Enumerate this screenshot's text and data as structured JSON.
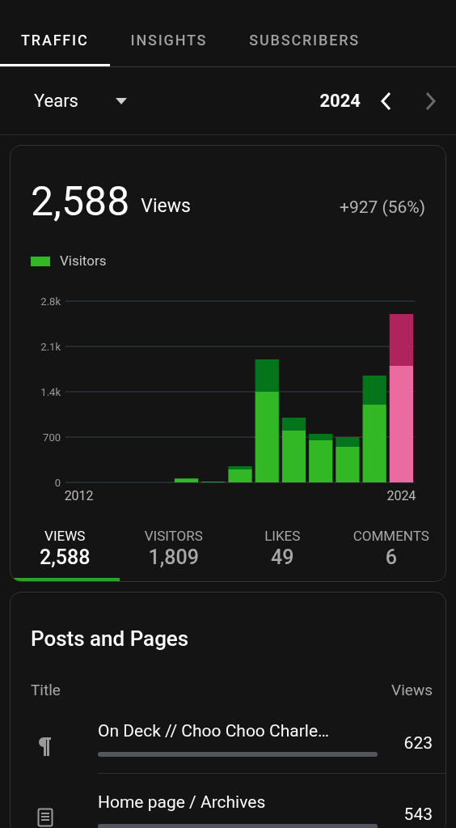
{
  "tabs": [
    {
      "label": "TRAFFIC",
      "selected": true
    },
    {
      "label": "INSIGHTS",
      "selected": false
    },
    {
      "label": "SUBSCRIBERS",
      "selected": false
    }
  ],
  "period": {
    "value": "Years",
    "year": "2024",
    "prev_enabled": true,
    "next_enabled": false
  },
  "summary": {
    "total": "2,588",
    "unit": "Views",
    "change": "+927 (56%)",
    "chart_data": {
      "type": "bar",
      "stacked": true,
      "grid": true,
      "x": [
        2012,
        2013,
        2014,
        2015,
        2016,
        2017,
        2018,
        2019,
        2020,
        2021,
        2022,
        2023,
        2024
      ],
      "series": [
        {
          "name": "Visitors",
          "color": "#32b825",
          "values": [
            0,
            0,
            0,
            0,
            60,
            10,
            200,
            1400,
            800,
            650,
            550,
            1200,
            null
          ]
        },
        {
          "color": "#05751b",
          "values": [
            0,
            0,
            0,
            0,
            0,
            0,
            50,
            500,
            200,
            100,
            150,
            450,
            null
          ]
        },
        {
          "color": "#eb6aa0",
          "values": [
            null,
            null,
            null,
            null,
            null,
            null,
            null,
            null,
            null,
            null,
            null,
            null,
            1800
          ]
        },
        {
          "color": "#b0245e",
          "values": [
            null,
            null,
            null,
            null,
            null,
            null,
            null,
            null,
            null,
            null,
            null,
            null,
            800
          ]
        }
      ],
      "xlim": [
        2011.5,
        2024.5
      ],
      "ylim": [
        0,
        2800
      ],
      "yticks": [
        {
          "value": 0,
          "label": "0"
        },
        {
          "value": 700,
          "label": "700"
        },
        {
          "value": 1400,
          "label": "1.4k"
        },
        {
          "value": 2100,
          "label": "2.1k"
        },
        {
          "value": 2800,
          "label": "2.8k"
        }
      ],
      "xticks": [
        {
          "value": 2012,
          "label": "2012"
        },
        {
          "value": 2024,
          "label": "2024"
        }
      ]
    },
    "stats": [
      {
        "label": "VIEWS",
        "value": "2,588",
        "selected": true
      },
      {
        "label": "VISITORS",
        "value": "1,809",
        "selected": false
      },
      {
        "label": "LIKES",
        "value": "49",
        "selected": false
      },
      {
        "label": "COMMENTS",
        "value": "6",
        "selected": false
      }
    ]
  },
  "posts": {
    "title": "Posts and Pages",
    "columns": [
      "Title",
      "Views"
    ],
    "rows": [
      {
        "kind": "post",
        "title": "On Deck // Choo Choo Charle…",
        "views": "623"
      },
      {
        "kind": "page",
        "title": "Home page / Archives",
        "views": "543"
      }
    ]
  }
}
